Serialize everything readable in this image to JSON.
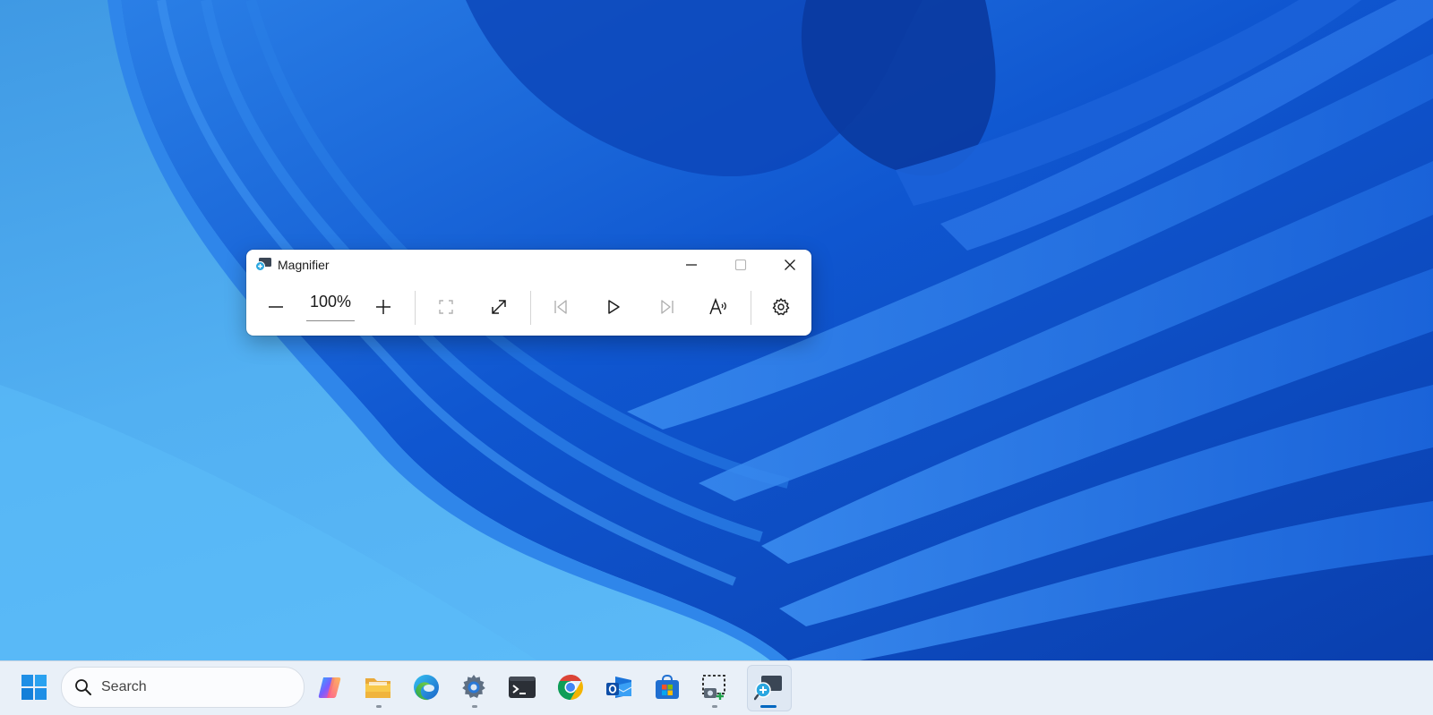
{
  "window": {
    "title": "Magnifier",
    "zoom_level": "100%"
  },
  "caption_buttons": [
    "minimize-icon",
    "maximize-icon",
    "close-icon"
  ],
  "toolbar": {
    "buttons": [
      {
        "name": "zoom-out",
        "icon": "minus-icon",
        "enabled": true
      },
      {
        "name": "zoom-in",
        "icon": "plus-icon",
        "enabled": true
      },
      {
        "name": "full-screen-view",
        "icon": "full-screen-icon",
        "enabled": false
      },
      {
        "name": "change-view",
        "icon": "expand-diagonal-icon",
        "enabled": true
      },
      {
        "name": "read-previous",
        "icon": "skip-previous-icon",
        "enabled": false
      },
      {
        "name": "read-play",
        "icon": "play-icon",
        "enabled": true
      },
      {
        "name": "read-next",
        "icon": "skip-next-icon",
        "enabled": false
      },
      {
        "name": "read-from-here",
        "icon": "read-aloud-icon",
        "enabled": true
      },
      {
        "name": "settings",
        "icon": "gear-icon",
        "enabled": true
      }
    ]
  },
  "taskbar": {
    "search_placeholder": "Search",
    "apps": [
      {
        "name": "copilot",
        "icon": "copilot-icon",
        "running": false
      },
      {
        "name": "file-explorer",
        "icon": "folder-icon",
        "running": true
      },
      {
        "name": "edge",
        "icon": "edge-icon",
        "running": false
      },
      {
        "name": "settings",
        "icon": "gear-icon",
        "running": true
      },
      {
        "name": "terminal",
        "icon": "terminal-icon",
        "running": false
      },
      {
        "name": "chrome",
        "icon": "chrome-icon",
        "running": false
      },
      {
        "name": "outlook",
        "icon": "outlook-icon",
        "running": false
      },
      {
        "name": "store",
        "icon": "store-icon",
        "running": false
      },
      {
        "name": "snipping-tool",
        "icon": "snipping-tool-icon",
        "running": true
      },
      {
        "name": "magnifier",
        "icon": "magnifier-icon",
        "running": true,
        "active": true
      }
    ]
  },
  "colors": {
    "accent": "#0067c0",
    "wallpaper_base": "#4aa8ee",
    "wallpaper_ribbon": "#1560d6"
  }
}
